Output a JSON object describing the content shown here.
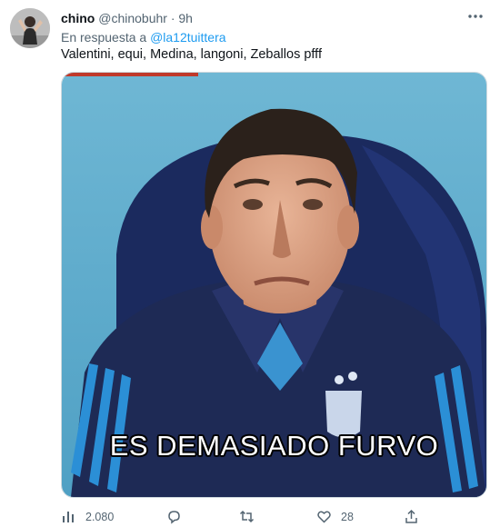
{
  "tweet": {
    "author_name": "chino",
    "author_handle": "@chinobuhr",
    "separator": "·",
    "time": "9h",
    "reply_prefix": "En respuesta a",
    "reply_mention": "@la12tuittera",
    "text": "Valentini, equi, Medina, langoni, Zeballos pfff",
    "image_caption": "ES DEMASIADO FURVO"
  },
  "actions": {
    "views": "2.080",
    "likes": "28"
  },
  "icons": [
    "avatar",
    "more-options-icon",
    "views-icon",
    "reply-icon",
    "retweet-icon",
    "like-icon",
    "share-icon"
  ],
  "colors": {
    "link": "#1d9bf0",
    "secondary_text": "#536471"
  }
}
